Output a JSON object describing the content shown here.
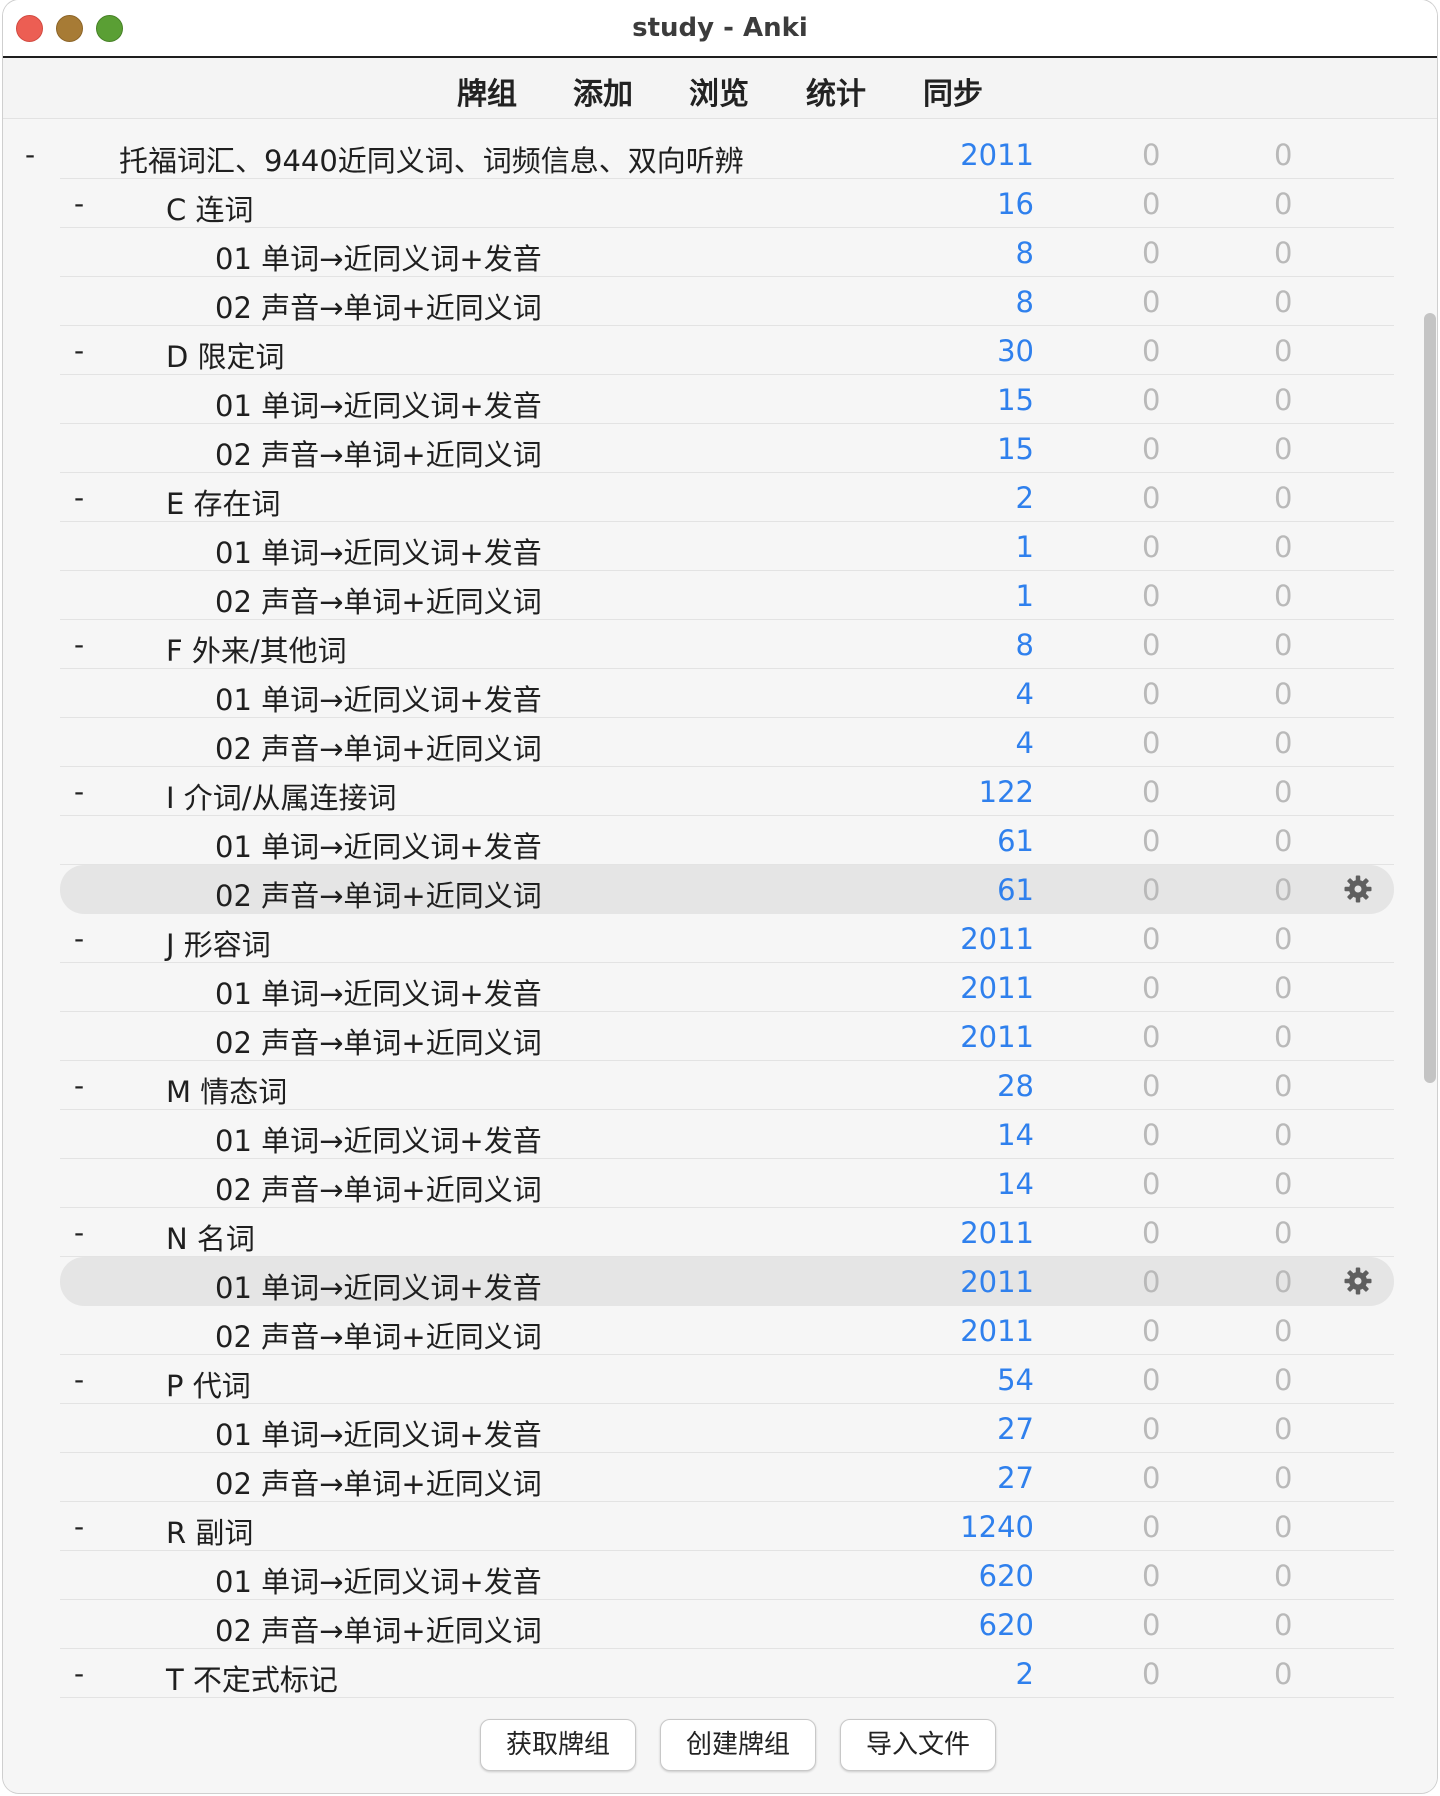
{
  "window": {
    "title": "study - Anki"
  },
  "toolbar": {
    "decks_label": "牌组",
    "add_label": "添加",
    "browse_label": "浏览",
    "stats_label": "统计",
    "sync_label": "同步"
  },
  "decks": [
    {
      "level": 0,
      "collapse": "-",
      "name": "托福词汇、9440近同义词、词频信息、双向听辨",
      "new": "2011",
      "learn": "0",
      "due": "0",
      "selected": false
    },
    {
      "level": 1,
      "collapse": "-",
      "name": "C 连词",
      "new": "16",
      "learn": "0",
      "due": "0",
      "selected": false
    },
    {
      "level": 2,
      "collapse": "",
      "name": "01 单词→近同义词+发音",
      "new": "8",
      "learn": "0",
      "due": "0",
      "selected": false
    },
    {
      "level": 2,
      "collapse": "",
      "name": "02 声音→单词+近同义词",
      "new": "8",
      "learn": "0",
      "due": "0",
      "selected": false
    },
    {
      "level": 1,
      "collapse": "-",
      "name": "D 限定词",
      "new": "30",
      "learn": "0",
      "due": "0",
      "selected": false
    },
    {
      "level": 2,
      "collapse": "",
      "name": "01 单词→近同义词+发音",
      "new": "15",
      "learn": "0",
      "due": "0",
      "selected": false
    },
    {
      "level": 2,
      "collapse": "",
      "name": "02 声音→单词+近同义词",
      "new": "15",
      "learn": "0",
      "due": "0",
      "selected": false
    },
    {
      "level": 1,
      "collapse": "-",
      "name": "E 存在词",
      "new": "2",
      "learn": "0",
      "due": "0",
      "selected": false
    },
    {
      "level": 2,
      "collapse": "",
      "name": "01 单词→近同义词+发音",
      "new": "1",
      "learn": "0",
      "due": "0",
      "selected": false
    },
    {
      "level": 2,
      "collapse": "",
      "name": "02 声音→单词+近同义词",
      "new": "1",
      "learn": "0",
      "due": "0",
      "selected": false
    },
    {
      "level": 1,
      "collapse": "-",
      "name": "F 外来/其他词",
      "new": "8",
      "learn": "0",
      "due": "0",
      "selected": false
    },
    {
      "level": 2,
      "collapse": "",
      "name": "01 单词→近同义词+发音",
      "new": "4",
      "learn": "0",
      "due": "0",
      "selected": false
    },
    {
      "level": 2,
      "collapse": "",
      "name": "02 声音→单词+近同义词",
      "new": "4",
      "learn": "0",
      "due": "0",
      "selected": false
    },
    {
      "level": 1,
      "collapse": "-",
      "name": "I 介词/从属连接词",
      "new": "122",
      "learn": "0",
      "due": "0",
      "selected": false
    },
    {
      "level": 2,
      "collapse": "",
      "name": "01 单词→近同义词+发音",
      "new": "61",
      "learn": "0",
      "due": "0",
      "selected": false
    },
    {
      "level": 2,
      "collapse": "",
      "name": "02 声音→单词+近同义词",
      "new": "61",
      "learn": "0",
      "due": "0",
      "selected": true
    },
    {
      "level": 1,
      "collapse": "-",
      "name": "J 形容词",
      "new": "2011",
      "learn": "0",
      "due": "0",
      "selected": false
    },
    {
      "level": 2,
      "collapse": "",
      "name": "01 单词→近同义词+发音",
      "new": "2011",
      "learn": "0",
      "due": "0",
      "selected": false
    },
    {
      "level": 2,
      "collapse": "",
      "name": "02 声音→单词+近同义词",
      "new": "2011",
      "learn": "0",
      "due": "0",
      "selected": false
    },
    {
      "level": 1,
      "collapse": "-",
      "name": "M 情态词",
      "new": "28",
      "learn": "0",
      "due": "0",
      "selected": false
    },
    {
      "level": 2,
      "collapse": "",
      "name": "01 单词→近同义词+发音",
      "new": "14",
      "learn": "0",
      "due": "0",
      "selected": false
    },
    {
      "level": 2,
      "collapse": "",
      "name": "02 声音→单词+近同义词",
      "new": "14",
      "learn": "0",
      "due": "0",
      "selected": false
    },
    {
      "level": 1,
      "collapse": "-",
      "name": "N 名词",
      "new": "2011",
      "learn": "0",
      "due": "0",
      "selected": false
    },
    {
      "level": 2,
      "collapse": "",
      "name": "01 单词→近同义词+发音",
      "new": "2011",
      "learn": "0",
      "due": "0",
      "selected": true
    },
    {
      "level": 2,
      "collapse": "",
      "name": "02 声音→单词+近同义词",
      "new": "2011",
      "learn": "0",
      "due": "0",
      "selected": false
    },
    {
      "level": 1,
      "collapse": "-",
      "name": "P 代词",
      "new": "54",
      "learn": "0",
      "due": "0",
      "selected": false
    },
    {
      "level": 2,
      "collapse": "",
      "name": "01 单词→近同义词+发音",
      "new": "27",
      "learn": "0",
      "due": "0",
      "selected": false
    },
    {
      "level": 2,
      "collapse": "",
      "name": "02 声音→单词+近同义词",
      "new": "27",
      "learn": "0",
      "due": "0",
      "selected": false
    },
    {
      "level": 1,
      "collapse": "-",
      "name": "R 副词",
      "new": "1240",
      "learn": "0",
      "due": "0",
      "selected": false
    },
    {
      "level": 2,
      "collapse": "",
      "name": "01 单词→近同义词+发音",
      "new": "620",
      "learn": "0",
      "due": "0",
      "selected": false
    },
    {
      "level": 2,
      "collapse": "",
      "name": "02 声音→单词+近同义词",
      "new": "620",
      "learn": "0",
      "due": "0",
      "selected": false
    },
    {
      "level": 1,
      "collapse": "-",
      "name": "T 不定式标记",
      "new": "2",
      "learn": "0",
      "due": "0",
      "selected": false
    }
  ],
  "bottom_buttons": {
    "get_shared_label": "获取牌组",
    "create_deck_label": "创建牌组",
    "import_file_label": "导入文件"
  },
  "colors": {
    "new_count": "#2f80ed",
    "zero_count": "#b9b9b9",
    "selected_row": "#e5e5e5"
  },
  "icons": {
    "row_options": "gear-icon"
  }
}
